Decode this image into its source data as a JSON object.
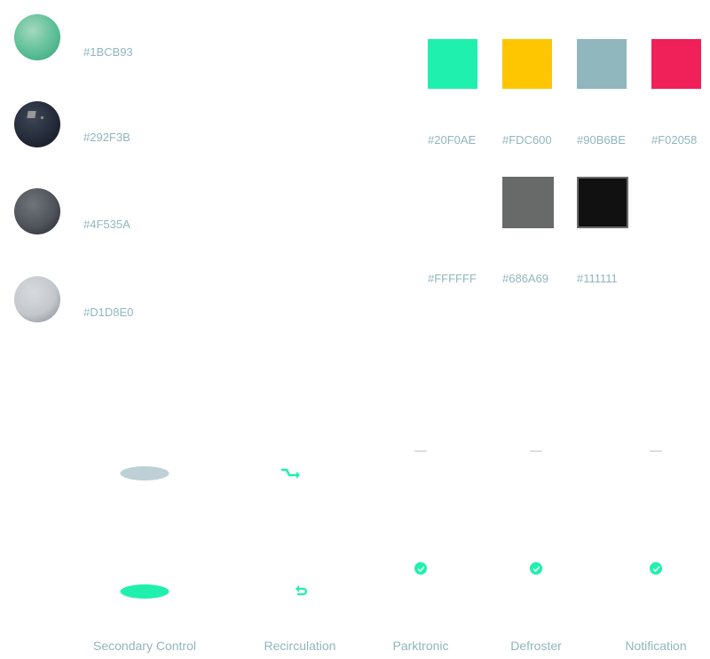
{
  "spheres": [
    {
      "label": "#1BCB93",
      "color": "#1BCB93"
    },
    {
      "label": "#292F3B",
      "color": "#292F3B"
    },
    {
      "label": "#4F535A",
      "color": "#4F535A"
    },
    {
      "label": "#D1D8E0",
      "color": "#D1D8E0"
    }
  ],
  "swatches": [
    {
      "label": "#20F0AE",
      "color": "#20F0AE"
    },
    {
      "label": "#FDC600",
      "color": "#FDC600"
    },
    {
      "label": "#90B6BE",
      "color": "#90B6BE"
    },
    {
      "label": "#F02058",
      "color": "#F02058"
    },
    {
      "label": "#FFFFFF",
      "color": "#FFFFFF"
    },
    {
      "label": "#686A69",
      "color": "#686A69"
    },
    {
      "label": "#111111",
      "color": "#111111"
    }
  ],
  "components": {
    "secondary_control": "Secondary Control",
    "recirculation": "Recirculation",
    "parktronic": "Parktronic",
    "defroster": "Defroster",
    "notification": "Notification"
  }
}
